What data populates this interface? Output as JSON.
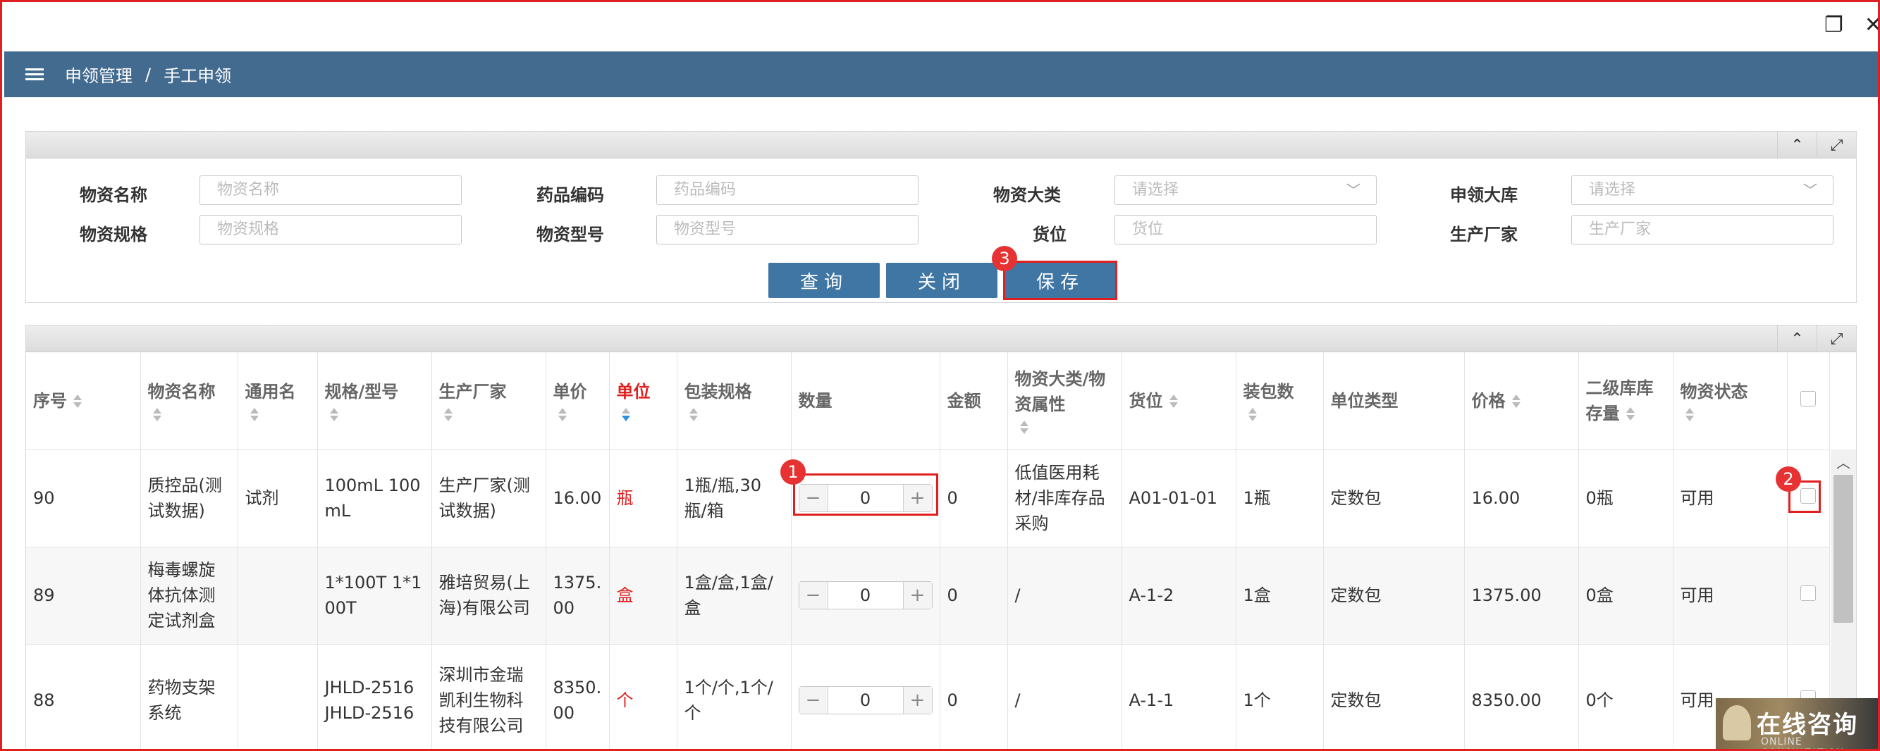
{
  "window": {
    "restore_icon": "restore-icon",
    "close_icon": "close-icon",
    "restore_glyph": "❐",
    "close_glyph": "✕"
  },
  "breadcrumb": {
    "parent": "申领管理",
    "separator": "/",
    "current": "手工申领"
  },
  "search": {
    "fields": {
      "material_name": {
        "label": "物资名称",
        "placeholder": "物资名称"
      },
      "drug_code": {
        "label": "药品编码",
        "placeholder": "药品编码"
      },
      "category": {
        "label": "物资大类",
        "placeholder": "请选择"
      },
      "warehouse": {
        "label": "申领大库",
        "placeholder": "请选择"
      },
      "spec": {
        "label": "物资规格",
        "placeholder": "物资规格"
      },
      "model": {
        "label": "物资型号",
        "placeholder": "物资型号"
      },
      "location": {
        "label": "货位",
        "placeholder": "货位"
      },
      "manufacturer": {
        "label": "生产厂家",
        "placeholder": "生产厂家"
      }
    },
    "buttons": {
      "query": "查询",
      "close": "关闭",
      "save": "保存"
    }
  },
  "panel_controls": {
    "collapse": "⌃",
    "expand": "⤢"
  },
  "annotations": {
    "one": "1",
    "two": "2",
    "three": "3"
  },
  "table": {
    "headers": {
      "seq": "序号",
      "name": "物资名称",
      "generic": "通用名",
      "spec": "规格/型号",
      "maker": "生产厂家",
      "price": "单价",
      "unit": "单位",
      "pack": "包装规格",
      "qty": "数量",
      "amount": "金额",
      "category": "物资大类/物资属性",
      "location": "货位",
      "pack_count": "装包数",
      "unit_type": "单位类型",
      "price2": "价格",
      "stock": "二级库库存量",
      "status": "物资状态"
    },
    "rows": [
      {
        "seq": "90",
        "name": "质控品(测试数据)",
        "generic": "试剂",
        "spec": "100mL 100mL",
        "maker": "生产厂家(测试数据)",
        "price": "16.00",
        "unit": "瓶",
        "pack": "1瓶/瓶,30瓶/箱",
        "qty": "0",
        "amount": "0",
        "category": "低值医用耗材/非库存品采购",
        "location": "A01-01-01",
        "pack_count": "1瓶",
        "unit_type": "定数包",
        "price2": "16.00",
        "stock": "0瓶",
        "status": "可用"
      },
      {
        "seq": "89",
        "name": "梅毒螺旋体抗体测定试剂盒",
        "generic": "",
        "spec": "1*100T 1*100T",
        "maker": "雅培贸易(上海)有限公司",
        "price": "1375.00",
        "unit": "盒",
        "pack": "1盒/盒,1盒/盒",
        "qty": "0",
        "amount": "0",
        "category": "/",
        "location": "A-1-2",
        "pack_count": "1盒",
        "unit_type": "定数包",
        "price2": "1375.00",
        "stock": "0盒",
        "status": "可用"
      },
      {
        "seq": "88",
        "name": "药物支架系统",
        "generic": "",
        "spec": "JHLD-2516 JHLD-2516",
        "maker": "深圳市金瑞凯利生物科技有限公司",
        "price": "8350.00",
        "unit": "个",
        "pack": "1个/个,1个/个",
        "qty": "0",
        "amount": "0",
        "category": "/",
        "location": "A-1-1",
        "pack_count": "1个",
        "unit_type": "定数包",
        "price2": "8350.00",
        "stock": "0个",
        "status": "可用"
      }
    ],
    "stepper": {
      "minus": "−",
      "plus": "+"
    }
  },
  "chat_widget": {
    "title": "在线咨询",
    "subtitle": "ONLINE CONSULTATION"
  },
  "colors": {
    "topbar": "#426b8f",
    "button": "#3f76a4",
    "highlight": "#e02020",
    "unit": "#e02020"
  }
}
